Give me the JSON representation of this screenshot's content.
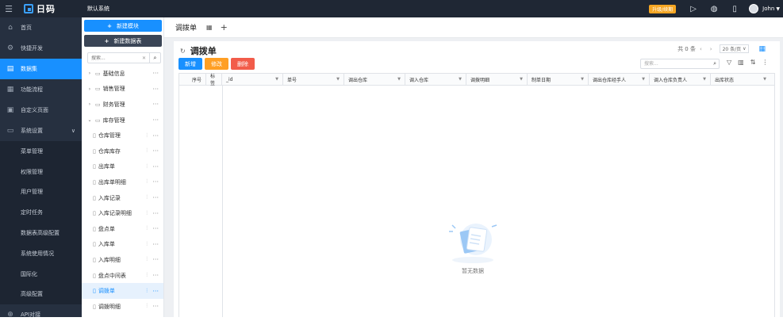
{
  "topbar": {
    "logo_text": "日码",
    "system_name": "默认系统",
    "upgrade_label": "升级/续期",
    "user_name": "John"
  },
  "sidebar": {
    "items": [
      {
        "label": "首页",
        "icon": "home-icon"
      },
      {
        "label": "快捷开发",
        "icon": "gear-icon"
      },
      {
        "label": "数据集",
        "icon": "database-icon",
        "active": true
      },
      {
        "label": "功能流程",
        "icon": "flow-icon"
      },
      {
        "label": "自定义页面",
        "icon": "page-icon"
      },
      {
        "label": "系统设置",
        "icon": "monitor-icon",
        "expanded": true
      }
    ],
    "sub_items": [
      "菜单管理",
      "权限管理",
      "用户管理",
      "定时任务",
      "数据表高级配置",
      "系统使用情况",
      "国际化",
      "高级配置"
    ],
    "bottom_item": {
      "label": "API对接",
      "icon": "api-icon"
    }
  },
  "tree": {
    "new_module": "新建模块",
    "new_table": "新建数据表",
    "search_placeholder": "搜索...",
    "folders": [
      {
        "label": "基础信息",
        "expanded": false
      },
      {
        "label": "销售管理",
        "expanded": false
      },
      {
        "label": "财务管理",
        "expanded": false
      },
      {
        "label": "库存管理",
        "expanded": true
      }
    ],
    "children": [
      "仓库管理",
      "仓库库存",
      "出库单",
      "出库单明细",
      "入库记录",
      "入库记录明细",
      "盘点单",
      "入库单",
      "入库明细",
      "盘点中间表",
      "调拨单",
      "调拨明细"
    ],
    "active_child": "调拨单"
  },
  "main": {
    "tab_title": "调拨单",
    "panel_title": "调拨单",
    "total_text": "共 0 条",
    "page_size": "20 条/页",
    "buttons": {
      "new": "新增",
      "edit": "修改",
      "delete": "删除"
    },
    "search_placeholder": "搜索...",
    "columns": [
      "序号",
      "标签",
      "_id",
      "单号",
      "调出仓库",
      "调入仓库",
      "调拨明细",
      "制单日期",
      "调出仓库经手人",
      "调入仓库负责人",
      "出库状态"
    ],
    "empty_text": "暂无数据"
  },
  "colors": {
    "accent": "#1890ff",
    "sidebar_bg": "#263040",
    "topbar_bg": "#1f2734",
    "edit_btn": "#ff9f24",
    "delete_btn": "#f25c4a",
    "upgrade": "#f5a623"
  }
}
